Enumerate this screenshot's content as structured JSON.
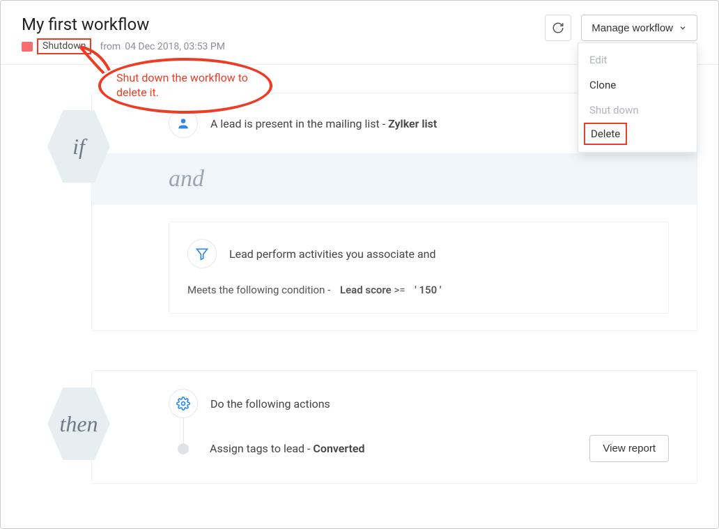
{
  "header": {
    "title": "My first workflow",
    "status_badge": "Shutdown",
    "from_label": "from",
    "from_date": "04 Dec 2018, 03:53 PM",
    "manage_label": "Manage workflow"
  },
  "dropdown": {
    "edit": "Edit",
    "clone": "Clone",
    "shutdown": "Shut down",
    "delete": "Delete"
  },
  "annotation": {
    "text": "Shut down the workflow to delete it."
  },
  "if_block": {
    "hex": "if",
    "trigger_prefix": "A lead is present in the mailing list - ",
    "trigger_list": "Zylker list",
    "and_label": "and",
    "activity_header": "Lead perform activities you associate and",
    "condition_prefix": "Meets the following condition -",
    "condition_field": "Lead score",
    "condition_op": ">=",
    "condition_value": "' 150 '"
  },
  "then_block": {
    "hex": "then",
    "actions_header": "Do the following actions",
    "action_prefix": "Assign tags to lead - ",
    "action_tag": "Converted",
    "view_report": "View report"
  }
}
